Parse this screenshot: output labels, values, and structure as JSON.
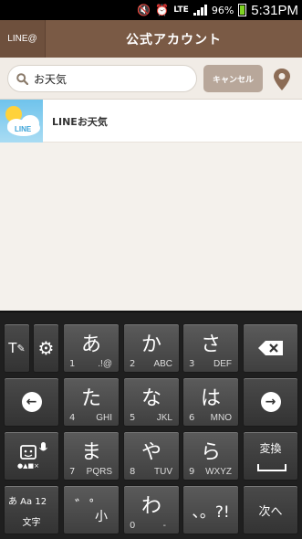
{
  "status_bar": {
    "lte": "LTE",
    "battery": "96%",
    "time": "5:31PM"
  },
  "header": {
    "back_label": "LINE@",
    "title": "公式アカウント"
  },
  "search": {
    "value": "お天気",
    "placeholder": "",
    "cancel_label": "キャンセル"
  },
  "results": [
    {
      "name": "LINEお天気",
      "thumb_text": "LINE"
    }
  ],
  "keyboard": {
    "keys": {
      "a": {
        "kana": "あ",
        "num": "1",
        "sub": ".!@"
      },
      "ka": {
        "kana": "か",
        "num": "2",
        "sub": "ABC"
      },
      "sa": {
        "kana": "さ",
        "num": "3",
        "sub": "DEF"
      },
      "ta": {
        "kana": "た",
        "num": "4",
        "sub": "GHI"
      },
      "na": {
        "kana": "な",
        "num": "5",
        "sub": "JKL"
      },
      "ha": {
        "kana": "は",
        "num": "6",
        "sub": "MNO"
      },
      "ma": {
        "kana": "ま",
        "num": "7",
        "sub": "PQRS"
      },
      "ya": {
        "kana": "や",
        "num": "8",
        "sub": "TUV"
      },
      "ra": {
        "kana": "ら",
        "num": "9",
        "sub": "WXYZ"
      },
      "wa": {
        "kana": "わ",
        "num": "0",
        "sub": "-"
      },
      "dakuten": {
        "label": "小"
      },
      "punct": {
        "label": "、。?!"
      }
    },
    "henkan_label": "変換",
    "next_label": "次へ",
    "mode": {
      "top": "あ Aa 12",
      "bottom": "文字"
    }
  }
}
